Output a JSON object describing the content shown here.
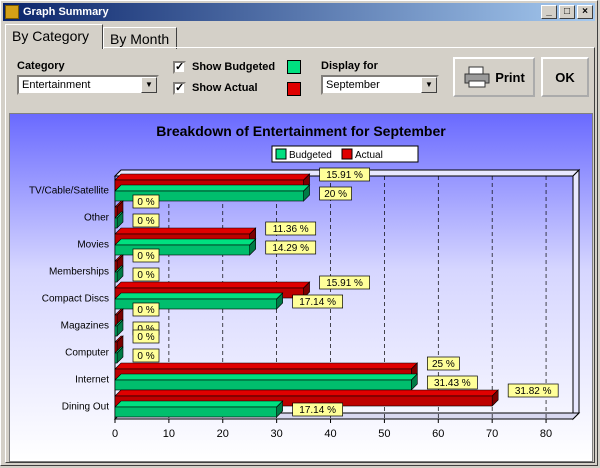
{
  "window": {
    "title": "Graph Summary"
  },
  "tabs": [
    {
      "label": "By Category",
      "active": true
    },
    {
      "label": "By Month",
      "active": false
    }
  ],
  "controls": {
    "category_label": "Category",
    "category_value": "Entertainment",
    "show_budgeted_label": "Show Budgeted",
    "show_actual_label": "Show Actual",
    "display_for_label": "Display for",
    "display_for_value": "September",
    "print_label": "Print",
    "ok_label": "OK"
  },
  "colors": {
    "budgeted": "#00e080",
    "actual": "#e00000",
    "label_bg": "#ffff99"
  },
  "chart_data": {
    "type": "bar",
    "orientation": "horizontal",
    "title": "Breakdown of Entertainment for September",
    "categories": [
      "TV/Cable/Satellite",
      "Other",
      "Movies",
      "Memberships",
      "Compact Discs",
      "Magazines",
      "Computer",
      "Internet",
      "Dining Out"
    ],
    "series": [
      {
        "name": "Budgeted",
        "values": [
          35,
          0,
          25,
          0,
          30,
          0,
          0,
          55,
          30
        ],
        "labels": [
          "20 %",
          "0 %",
          "14.29 %",
          "0 %",
          "17.14 %",
          "0 %",
          "0 %",
          "31.43 %",
          "17.14 %"
        ]
      },
      {
        "name": "Actual",
        "values": [
          35,
          0,
          25,
          0,
          35,
          0,
          0,
          55,
          70
        ],
        "labels": [
          "15.91 %",
          "0 %",
          "11.36 %",
          "0 %",
          "15.91 %",
          "0 %",
          "0 %",
          "25 %",
          "31.82 %"
        ]
      }
    ],
    "xlim": [
      0,
      85
    ],
    "xticks": [
      0,
      10,
      20,
      30,
      40,
      50,
      60,
      70,
      80
    ],
    "grid": true,
    "legend": "top-center"
  }
}
